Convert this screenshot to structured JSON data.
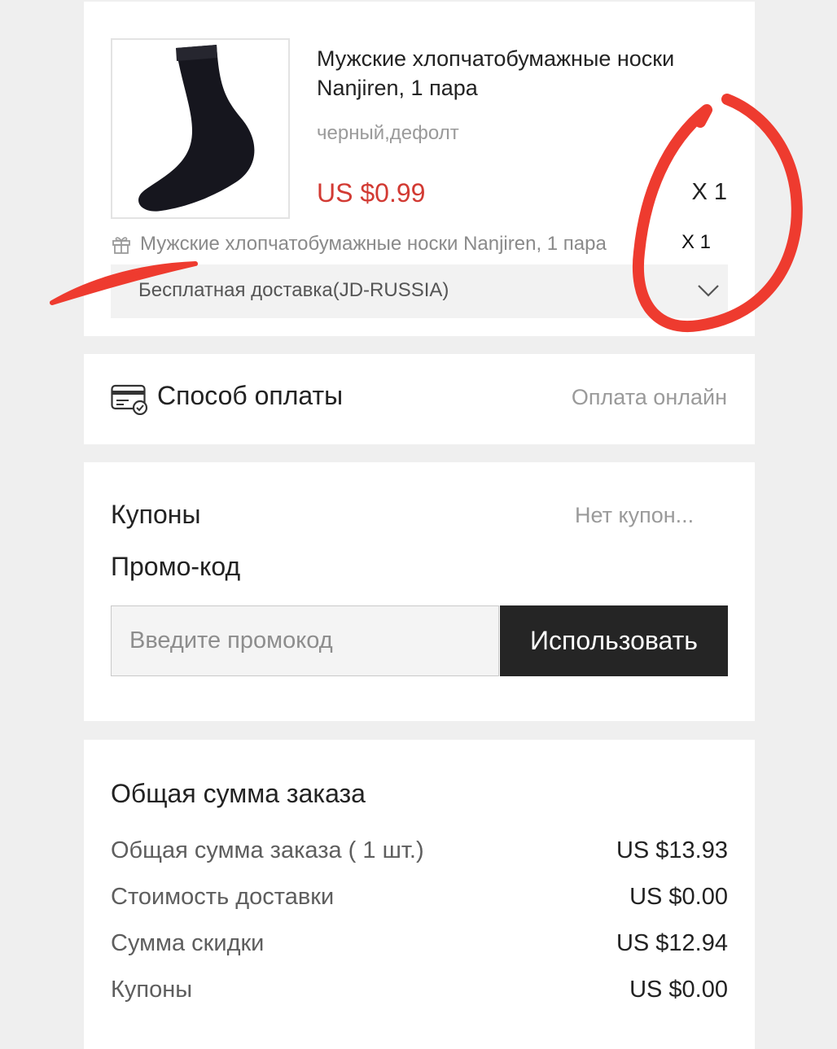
{
  "product": {
    "title": "Мужские хлопчатобумажные носки Nanjiren, 1 пара",
    "variant": "черный,дефолт",
    "price": "US $0.99",
    "quantity": "X 1",
    "image_icon": "sock-icon",
    "gift": {
      "icon": "gift-icon",
      "text": "Мужские хлопчатобумажные носки Nanjiren, 1 пара",
      "quantity": "X 1"
    },
    "shipping": {
      "label": "Бесплатная доставка(JD-RUSSIA)",
      "chevron_icon": "chevron-down-icon"
    }
  },
  "payment": {
    "icon": "credit-card-icon",
    "title": "Способ оплаты",
    "value": "Оплата онлайн"
  },
  "coupons": {
    "title": "Купоны",
    "value": "Нет купон...",
    "promo_title": "Промо-код",
    "promo_placeholder": "Введите промокод",
    "promo_value": "",
    "apply_label": "Использовать"
  },
  "summary": {
    "title": "Общая сумма заказа",
    "rows": [
      {
        "label": "Общая сумма заказа ( 1 шт.)",
        "value": "US $13.93"
      },
      {
        "label": "Стоимость доставки",
        "value": "US $0.00"
      },
      {
        "label": "Сумма скидки",
        "value": "US $12.94"
      },
      {
        "label": "Купоны",
        "value": "US $0.00"
      }
    ]
  },
  "colors": {
    "price": "#d23a33",
    "button_bg": "#252525",
    "page_bg": "#efefef",
    "annotation": "#ee3b2f"
  }
}
